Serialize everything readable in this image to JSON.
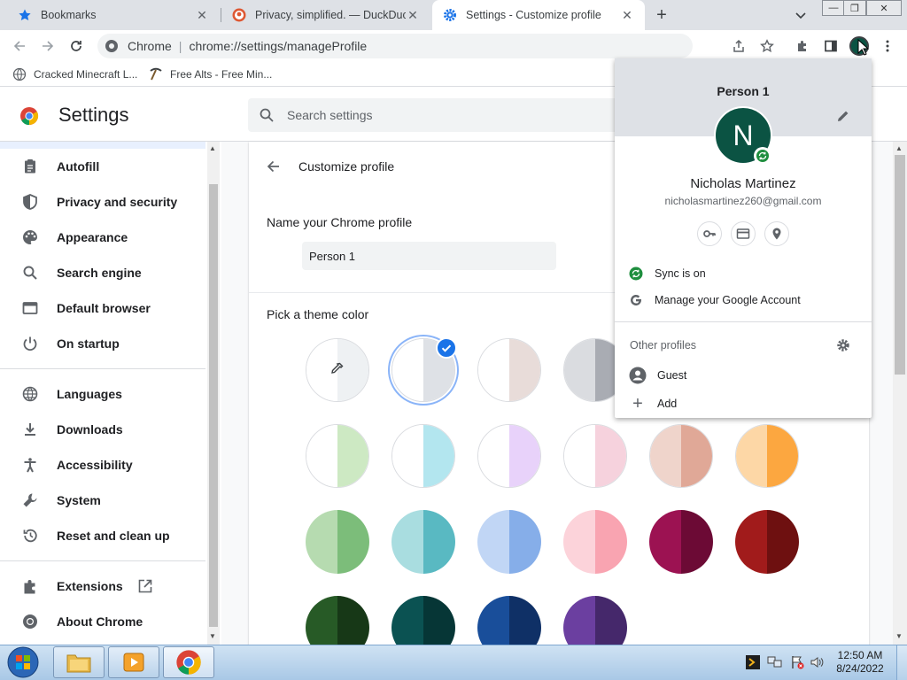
{
  "tabs": [
    {
      "title": "Bookmarks"
    },
    {
      "title": "Privacy, simplified. — DuckDuckGo"
    },
    {
      "title": "Settings - Customize profile"
    }
  ],
  "omnibox": {
    "label": "Chrome",
    "separator": "|",
    "url": "chrome://settings/manageProfile"
  },
  "bookmarks": [
    {
      "title": "Cracked Minecraft L..."
    },
    {
      "title": "Free Alts - Free Min..."
    }
  ],
  "settings": {
    "title": "Settings",
    "search_placeholder": "Search settings"
  },
  "sidebar": {
    "items": [
      {
        "label": "Autofill",
        "icon": "clipboard-icon"
      },
      {
        "label": "Privacy and security",
        "icon": "shield-icon"
      },
      {
        "label": "Appearance",
        "icon": "palette-icon"
      },
      {
        "label": "Search engine",
        "icon": "search-icon"
      },
      {
        "label": "Default browser",
        "icon": "browser-window-icon"
      },
      {
        "label": "On startup",
        "icon": "power-icon"
      },
      {
        "label": "Languages",
        "icon": "globe-icon"
      },
      {
        "label": "Downloads",
        "icon": "download-icon"
      },
      {
        "label": "Accessibility",
        "icon": "accessibility-icon"
      },
      {
        "label": "System",
        "icon": "wrench-icon"
      },
      {
        "label": "Reset and clean up",
        "icon": "history-icon"
      },
      {
        "label": "Extensions",
        "icon": "puzzle-icon"
      },
      {
        "label": "About Chrome",
        "icon": "chrome-icon"
      }
    ]
  },
  "customize": {
    "title": "Customize profile",
    "name_header": "Name your Chrome profile",
    "name_value": "Person 1",
    "theme_header": "Pick a theme color",
    "selected_theme_index": 1
  },
  "themes": [
    {
      "l": "#ffffff",
      "r": "#eef1f3"
    },
    {
      "l": "#ffffff",
      "r": "#dee1e6"
    },
    {
      "l": "#ffffff",
      "r": "#e8dcd9"
    },
    {
      "l": "#dadce0",
      "r": "#a9acb3"
    },
    {
      "l": "#ffffff",
      "r": "#fcdcc9"
    },
    {
      "l": "#ffffff",
      "r": "#fde163"
    },
    {
      "l": "#ffffff",
      "r": "#cde9c3"
    },
    {
      "l": "#ffffff",
      "r": "#b3e6ef"
    },
    {
      "l": "#ffffff",
      "r": "#e8d2fa"
    },
    {
      "l": "#ffffff",
      "r": "#f6d2dd"
    },
    {
      "l": "#efd4cb",
      "r": "#e0a897"
    },
    {
      "l": "#fdd7a6",
      "r": "#fca740"
    },
    {
      "l": "#b6dbb0",
      "r": "#7cbd7a"
    },
    {
      "l": "#a9dde0",
      "r": "#59b9c2"
    },
    {
      "l": "#c1d6f5",
      "r": "#86aee9"
    },
    {
      "l": "#fcd3da",
      "r": "#f9a4b1"
    },
    {
      "l": "#9c1252",
      "r": "#6c0a35"
    },
    {
      "l": "#a11b1b",
      "r": "#6e1010"
    },
    {
      "l": "#275a26",
      "r": "#173817"
    },
    {
      "l": "#0b5252",
      "r": "#063636"
    },
    {
      "l": "#194e9a",
      "r": "#0f3066"
    },
    {
      "l": "#6b3fa0",
      "r": "#45286b"
    }
  ],
  "profile_popup": {
    "title": "Person 1",
    "initial": "N",
    "name": "Nicholas Martinez",
    "email": "nicholasmartinez260@gmail.com",
    "sync": "Sync is on",
    "manage": "Manage your Google Account",
    "other_profiles": "Other profiles",
    "guest": "Guest",
    "add": "Add"
  },
  "taskbar": {
    "time": "12:50 AM",
    "date": "8/24/2022"
  },
  "colors": {
    "accent": "#1a73e8",
    "avatar_bg": "#0b5343",
    "sync_green": "#1e8e3e"
  }
}
